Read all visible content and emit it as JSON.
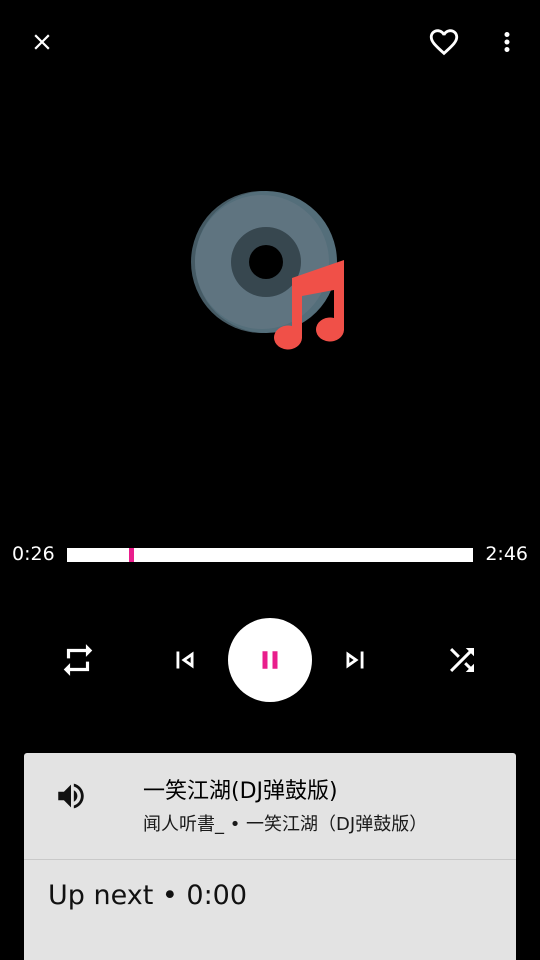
{
  "playback": {
    "elapsed": "0:26",
    "total": "2:46",
    "progress_fraction": 0.157,
    "is_playing": true
  },
  "track": {
    "title": "一笑江湖(DJ弹鼓版)",
    "subtitle": "闻人听書_ • 一笑江湖（DJ弹鼓版）"
  },
  "queue": {
    "up_next": "Up next  •  0:00"
  },
  "icons": {
    "close": "close-icon",
    "favorite": "heart-outline-icon",
    "more": "more-vert-icon",
    "repeat": "repeat-icon",
    "previous": "skip-previous-icon",
    "pause": "pause-icon",
    "next": "skip-next-icon",
    "shuffle": "shuffle-icon",
    "speaker": "volume-icon",
    "album_art": "music-disc-icon"
  },
  "colors": {
    "background": "#000000",
    "accent": "#e91e8c",
    "panel": "#e3e3e3",
    "note": "#f05048",
    "disc": "#546e7a"
  }
}
